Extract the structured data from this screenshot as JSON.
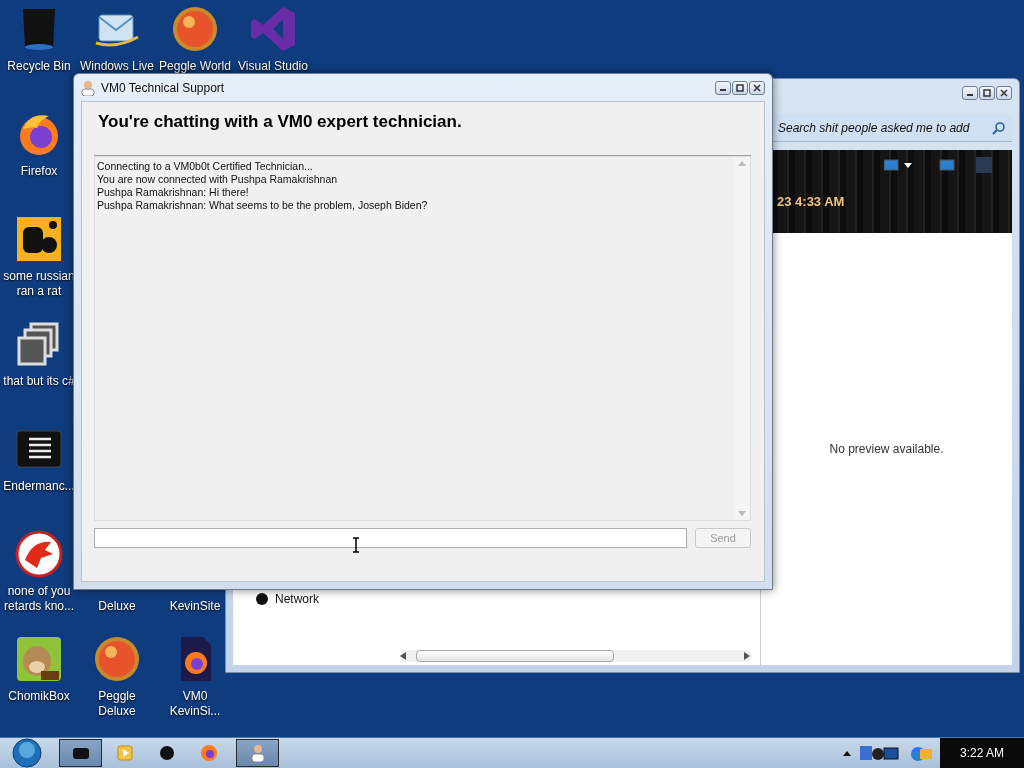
{
  "desktop": {
    "icons": [
      {
        "label": "Recycle Bin",
        "kind": "bin"
      },
      {
        "label": "Windows Live",
        "kind": "mail"
      },
      {
        "label": "Peggle World",
        "kind": "ball"
      },
      {
        "label": "Visual Studio",
        "kind": "ribbon"
      },
      {
        "label": "Firefox",
        "kind": "fox"
      },
      {
        "label": "some russian ran a rat",
        "kind": "tile"
      },
      {
        "label": "that but its c#",
        "kind": "stack"
      },
      {
        "label": "Endermanc...",
        "kind": "lines"
      },
      {
        "label": "none of you retards kno...",
        "kind": "dragon"
      },
      {
        "label": "Deluxe",
        "kind": "covered"
      },
      {
        "label": "KevinSite",
        "kind": "covered"
      },
      {
        "label": "ChomikBox",
        "kind": "hamster"
      },
      {
        "label": "Peggle Deluxe",
        "kind": "ball"
      },
      {
        "label": "VM0 KevinSi...",
        "kind": "foxdoc"
      }
    ]
  },
  "explorer_window": {
    "search": {
      "placeholder": "Search shit people asked me to add"
    },
    "banner_time": "23 4:33 AM",
    "preview_text": "No preview available.",
    "nav_item": "Network"
  },
  "chat_window": {
    "title": "VM0 Technical Support",
    "heading": "You're chatting with a VM0 expert technician.",
    "messages": [
      "Connecting to a VM0b0t Certified Technician...",
      "You are now connected with Pushpa Ramakrishnan",
      "Pushpa Ramakrishnan: Hi there!",
      "Pushpa Ramakrishnan: What seems to be the problem, Joseph Biden?"
    ],
    "send_button": {
      "label": "Send",
      "disabled": true
    }
  },
  "taskbar": {
    "buttons": [
      {
        "kind": "box",
        "selected": true
      },
      {
        "kind": "media",
        "selected": false
      },
      {
        "kind": "orb",
        "selected": false
      },
      {
        "kind": "fox",
        "selected": false
      },
      {
        "kind": "person",
        "selected": true
      }
    ],
    "clock": "3:22 AM"
  }
}
